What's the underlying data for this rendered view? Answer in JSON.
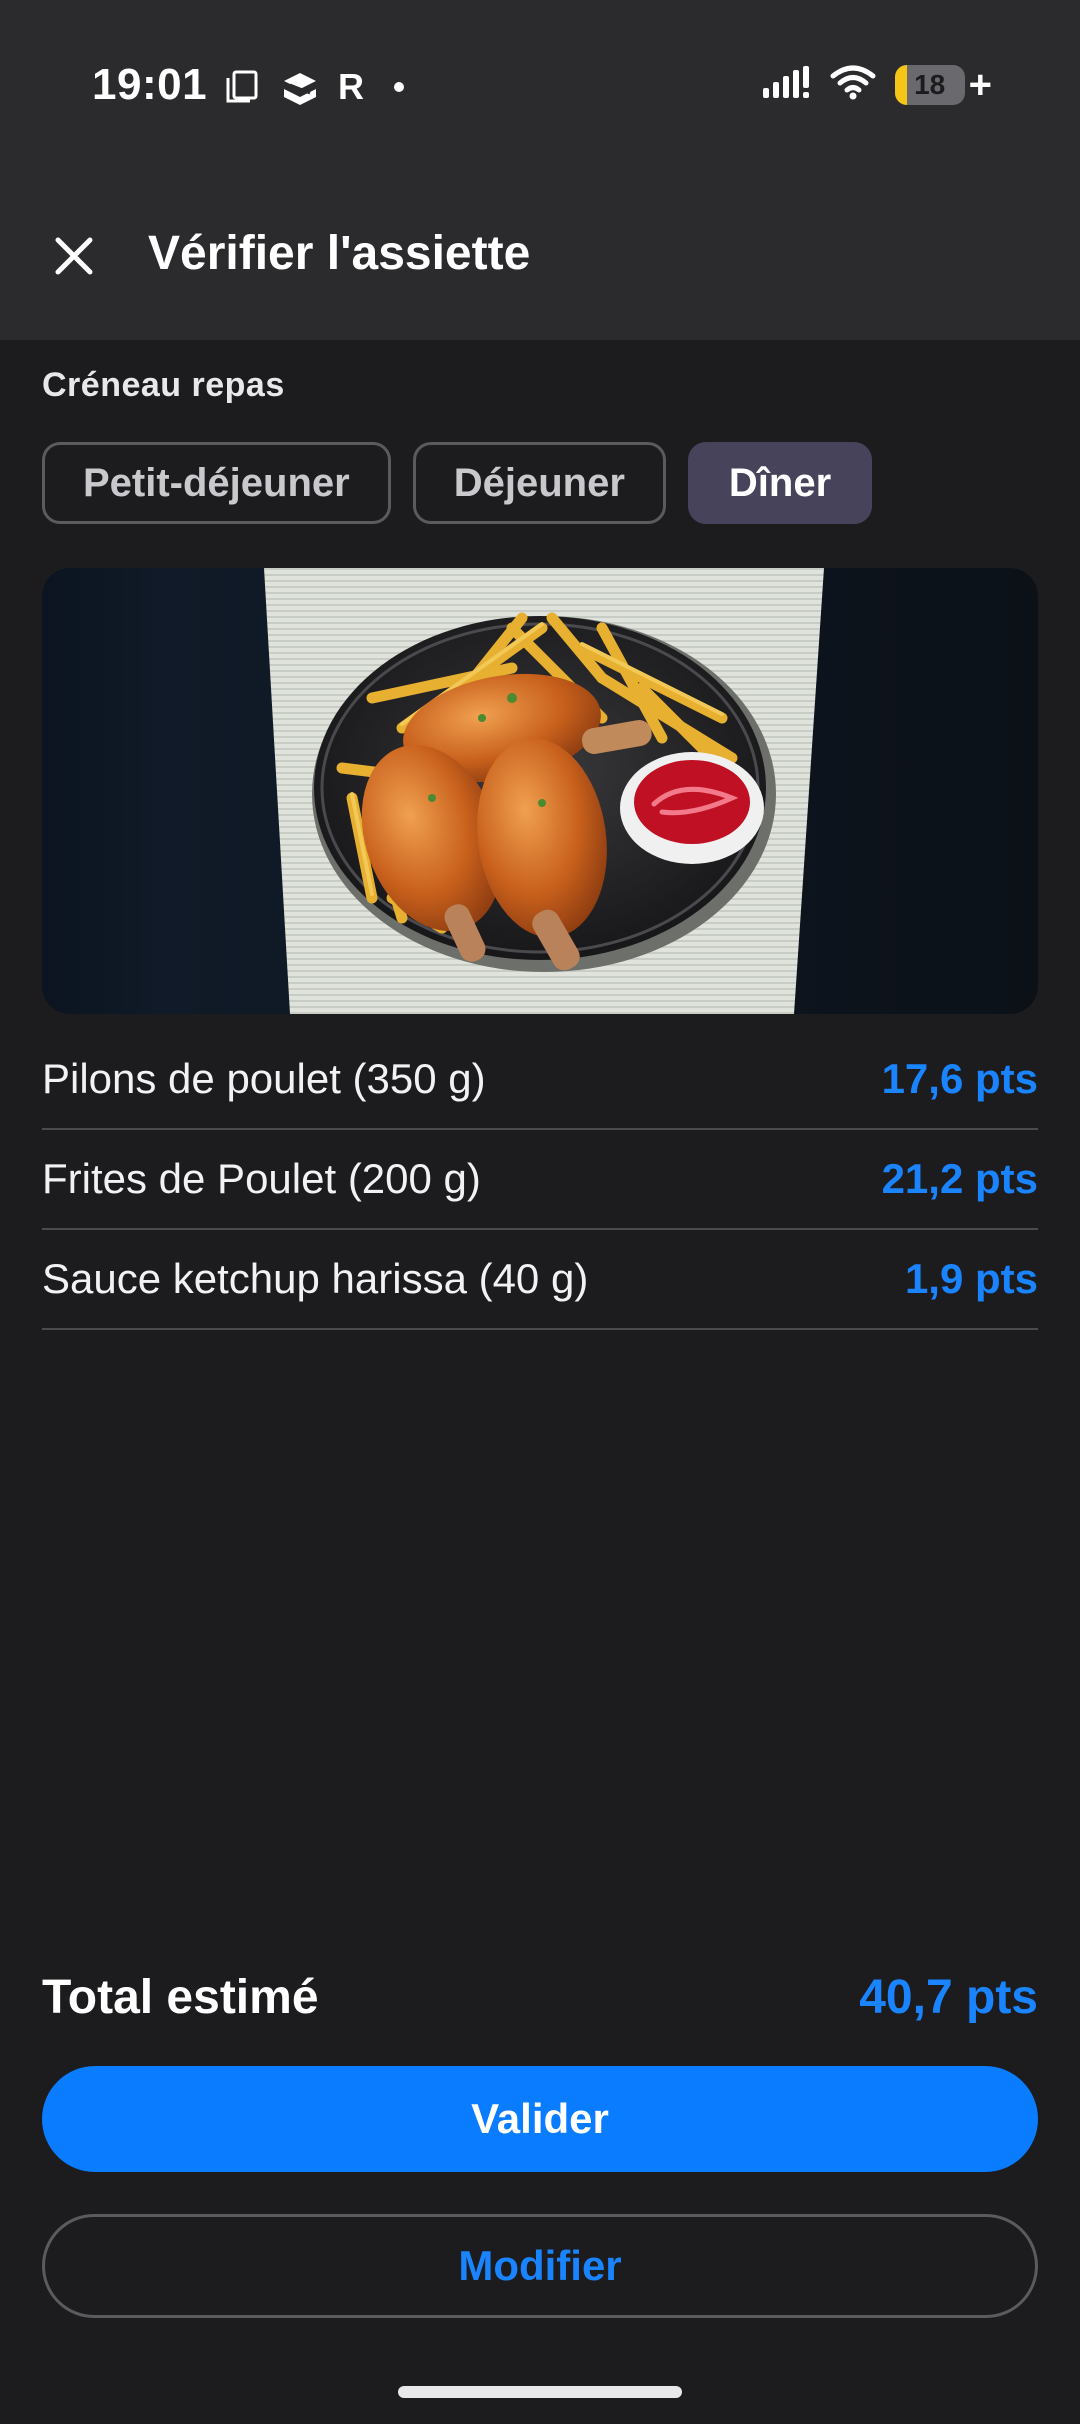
{
  "status_bar": {
    "time": "19:01",
    "carrier_letter": "R",
    "battery_percent": "18",
    "battery_level": 0.18,
    "charging": "+"
  },
  "header": {
    "title": "Vérifier l'assiette",
    "close_icon": "close-icon"
  },
  "meal_slot": {
    "label": "Créneau repas",
    "options": [
      "Petit-déjeuner",
      "Déjeuner",
      "Dîner"
    ],
    "selected": "Dîner"
  },
  "items": [
    {
      "name": "Pilons de poulet (350 g)",
      "points": "17,6 pts"
    },
    {
      "name": "Frites de Poulet (200 g)",
      "points": "21,2 pts"
    },
    {
      "name": "Sauce ketchup harissa (40 g)",
      "points": "1,9 pts"
    }
  ],
  "total": {
    "label": "Total estimé",
    "value": "40,7 pts"
  },
  "actions": {
    "validate_label": "Valider",
    "modify_label": "Modifier"
  },
  "colors": {
    "accent": "#0a7cff",
    "points": "#1a84ff",
    "background": "#1c1c1e",
    "header_bg": "#2b2b2e",
    "chip_active": "#46435a"
  }
}
